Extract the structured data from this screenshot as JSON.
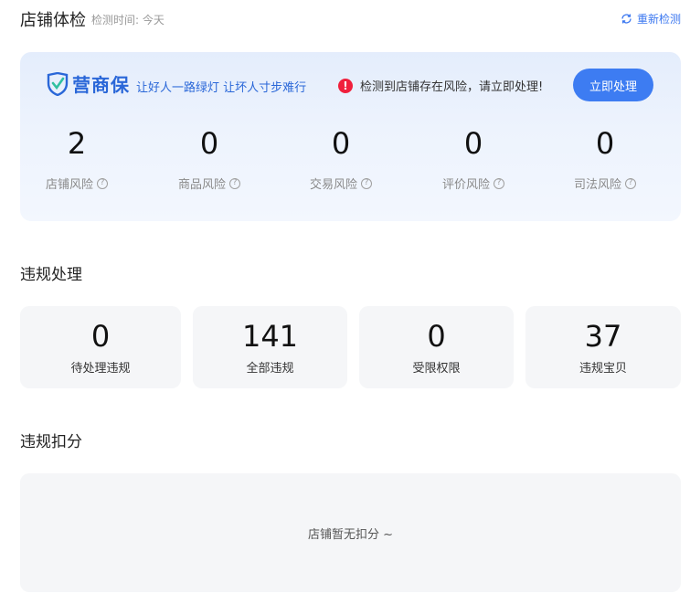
{
  "header": {
    "title": "店铺体检",
    "subtitle": "检测时间: 今天",
    "recheck_label": "重新检测"
  },
  "card": {
    "brand_name": "营商保",
    "slogan": "让好人一路绿灯 让坏人寸步难行",
    "alert_icon": "!",
    "alert_text": "检测到店铺存在风险，请立即处理!",
    "action_label": "立即处理",
    "risks": [
      {
        "value": "2",
        "label": "店铺风险",
        "help": "?"
      },
      {
        "value": "0",
        "label": "商品风险",
        "help": "?"
      },
      {
        "value": "0",
        "label": "交易风险",
        "help": "?"
      },
      {
        "value": "0",
        "label": "评价风险",
        "help": "?"
      },
      {
        "value": "0",
        "label": "司法风险",
        "help": "?"
      }
    ]
  },
  "violations": {
    "title": "违规处理",
    "tiles": [
      {
        "value": "0",
        "label": "待处理违规"
      },
      {
        "value": "141",
        "label": "全部违规"
      },
      {
        "value": "0",
        "label": "受限权限"
      },
      {
        "value": "37",
        "label": "违规宝贝"
      }
    ]
  },
  "deduction": {
    "title": "违规扣分",
    "empty_text": "店铺暂无扣分 ~"
  },
  "colors": {
    "accent": "#3d7cf2",
    "alert": "#f0203c",
    "brand": "#2a67d8"
  },
  "icons": {
    "recheck": "refresh-icon",
    "brand": "shield-logo-icon",
    "alert": "alert-circle-icon",
    "help": "question-circle-icon"
  }
}
